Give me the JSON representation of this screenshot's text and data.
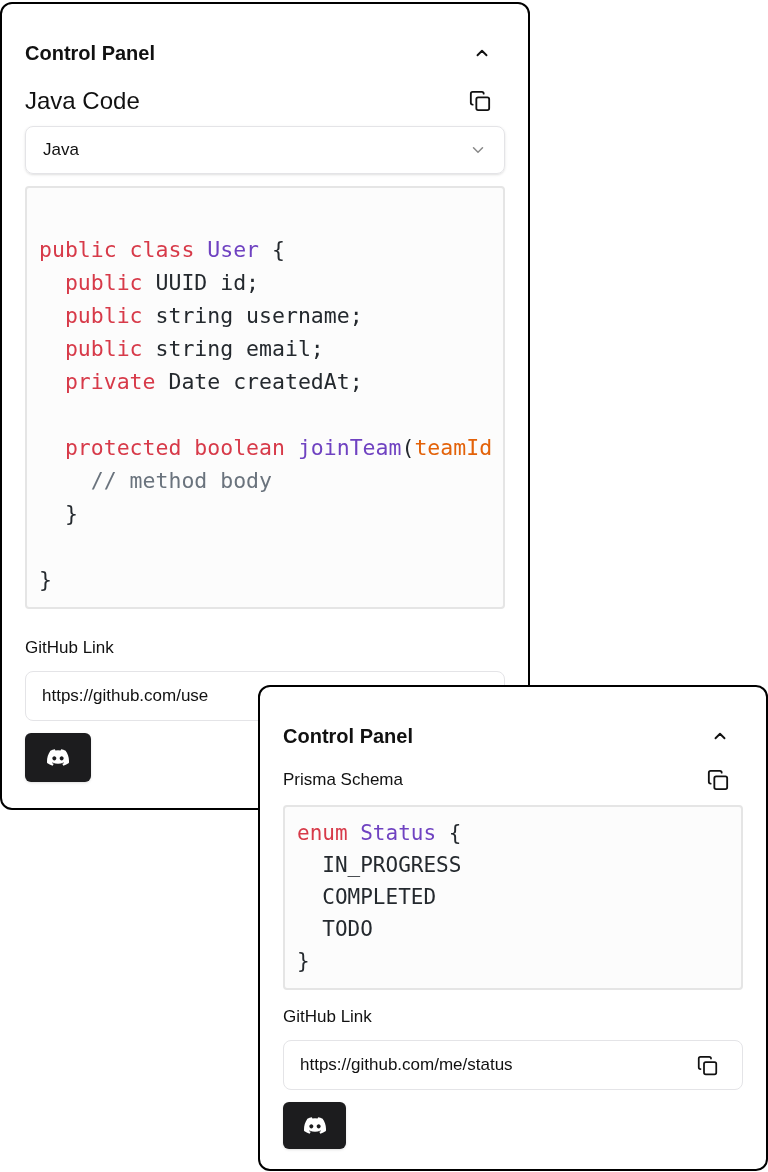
{
  "panels": [
    {
      "kind": "large",
      "title": "Control Panel",
      "expanded": true,
      "section_label": "Java Code",
      "language_select": {
        "value": "Java"
      },
      "code_lines": [
        {
          "kind": "blank"
        },
        {
          "kind": "code",
          "tokens": [
            {
              "kind": "keyword",
              "text": "public class "
            },
            {
              "kind": "type",
              "text": "User"
            },
            {
              "kind": "plain",
              "text": " {"
            }
          ]
        },
        {
          "kind": "code",
          "tokens": [
            {
              "kind": "keyword",
              "text": "  public"
            },
            {
              "kind": "plain",
              "text": " UUID id;"
            }
          ]
        },
        {
          "kind": "code",
          "tokens": [
            {
              "kind": "keyword",
              "text": "  public"
            },
            {
              "kind": "plain",
              "text": " string username;"
            }
          ]
        },
        {
          "kind": "code",
          "tokens": [
            {
              "kind": "keyword",
              "text": "  public"
            },
            {
              "kind": "plain",
              "text": " string email;"
            }
          ]
        },
        {
          "kind": "code",
          "tokens": [
            {
              "kind": "keyword",
              "text": "  private"
            },
            {
              "kind": "plain",
              "text": " Date createdAt;"
            }
          ]
        },
        {
          "kind": "blank"
        },
        {
          "kind": "code",
          "tokens": [
            {
              "kind": "keyword",
              "text": "  protected boolean "
            },
            {
              "kind": "type",
              "text": "joinTeam"
            },
            {
              "kind": "plain",
              "text": "("
            },
            {
              "kind": "param",
              "text": "teamId"
            }
          ]
        },
        {
          "kind": "code",
          "tokens": [
            {
              "kind": "comment",
              "text": "    // method body"
            }
          ]
        },
        {
          "kind": "code",
          "tokens": [
            {
              "kind": "plain",
              "text": "  }"
            }
          ]
        },
        {
          "kind": "blank"
        },
        {
          "kind": "code",
          "tokens": [
            {
              "kind": "plain",
              "text": "}"
            }
          ]
        }
      ],
      "link_label": "GitHub Link",
      "link_value": "https://github.com/use"
    },
    {
      "kind": "compact",
      "title": "Control Panel",
      "expanded": true,
      "section_label": "Prisma Schema",
      "code_lines": [
        {
          "kind": "code",
          "tokens": [
            {
              "kind": "keyword",
              "text": "enum "
            },
            {
              "kind": "type",
              "text": "Status"
            },
            {
              "kind": "plain",
              "text": " {"
            }
          ]
        },
        {
          "kind": "code",
          "tokens": [
            {
              "kind": "plain",
              "text": "  IN_PROGRESS"
            }
          ]
        },
        {
          "kind": "code",
          "tokens": [
            {
              "kind": "plain",
              "text": "  COMPLETED"
            }
          ]
        },
        {
          "kind": "code",
          "tokens": [
            {
              "kind": "plain",
              "text": "  TODO"
            }
          ]
        },
        {
          "kind": "code",
          "tokens": [
            {
              "kind": "plain",
              "text": "}"
            }
          ]
        }
      ],
      "link_label": "GitHub Link",
      "link_value": "https://github.com/me/status"
    }
  ]
}
